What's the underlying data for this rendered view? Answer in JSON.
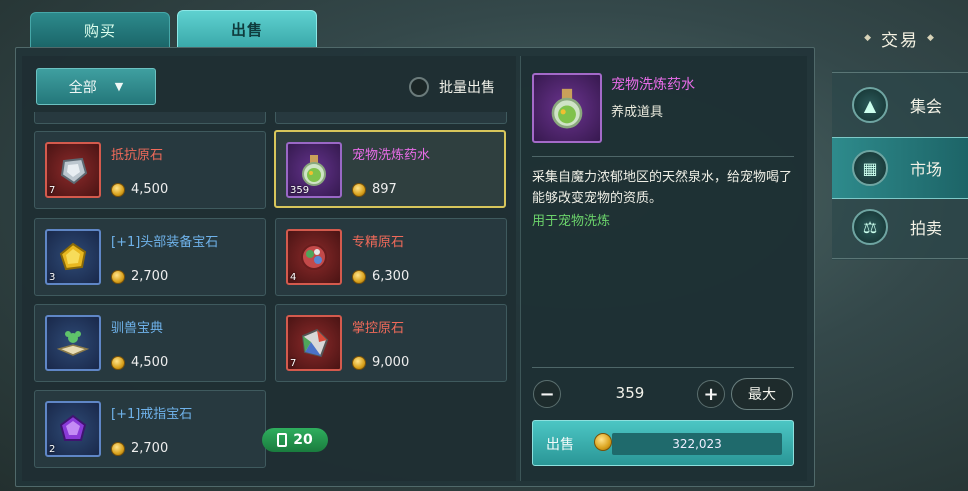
{
  "tabs": {
    "buy": "购买",
    "sell": "出售"
  },
  "filter": {
    "label": "全部"
  },
  "batch_sell_label": "批量出售",
  "items": [
    {
      "name": "抵抗原石",
      "qty": "7",
      "price": "4,500",
      "color": "red"
    },
    {
      "name": "宠物洗炼药水",
      "qty": "359",
      "price": "897",
      "color": "purple"
    },
    {
      "name": "[+1]头部装备宝石",
      "qty": "3",
      "price": "2,700",
      "color": "blue"
    },
    {
      "name": "专精原石",
      "qty": "4",
      "price": "6,300",
      "color": "red"
    },
    {
      "name": "驯兽宝典",
      "qty": "",
      "price": "4,500",
      "color": "blue"
    },
    {
      "name": "掌控原石",
      "qty": "7",
      "price": "9,000",
      "color": "red"
    },
    {
      "name": "[+1]戒指宝石",
      "qty": "2",
      "price": "2,700",
      "color": "purple"
    }
  ],
  "count_badge": "20",
  "detail": {
    "name": "宠物洗炼药水",
    "category": "养成道具",
    "description": "采集自魔力浓郁地区的天然泉水，给宠物喝了能够改变宠物的资质。",
    "usage": "用于宠物洗炼"
  },
  "quantity": {
    "minus": "−",
    "value": "359",
    "plus": "+",
    "max_label": "最大"
  },
  "sell": {
    "label": "出售",
    "total": "322,023"
  },
  "nav": {
    "title": "交易",
    "items": [
      {
        "label": "集会",
        "icon": "bag-icon"
      },
      {
        "label": "市场",
        "icon": "market-stall-icon"
      },
      {
        "label": "拍卖",
        "icon": "scales-icon"
      }
    ]
  }
}
